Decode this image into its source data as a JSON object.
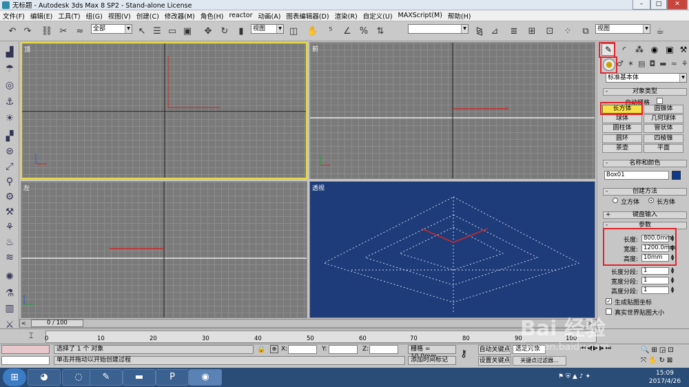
{
  "window": {
    "title": "无标题 - Autodesk 3ds Max 8 SP2  - Stand-alone License",
    "min": "–",
    "max": "□",
    "close": "✕"
  },
  "menu": [
    "文件(F)",
    "编辑(E)",
    "工具(T)",
    "组(G)",
    "视图(V)",
    "创建(C)",
    "修改器(M)",
    "角色(H)",
    "reactor",
    "动画(A)",
    "图表编辑器(D)",
    "渲染(R)",
    "自定义(U)",
    "MAXScript(M)",
    "帮助(H)"
  ],
  "toolbar": {
    "selection_filter": "全部",
    "ref_coord": "视图",
    "named_selection": "",
    "viewport_select": "视图"
  },
  "viewports": {
    "top": "顶",
    "front": "前",
    "left": "左",
    "perspective": "透视"
  },
  "cmd_panel": {
    "category": "标准基本体",
    "rollouts": {
      "object_type": "对象类型",
      "name_color": "名称和颜色",
      "creation_method": "创建方法",
      "keyboard_entry": "键盘输入",
      "parameters": "参数"
    },
    "autogrid": "自动栅格",
    "objects": [
      "长方体",
      "圆锥体",
      "球体",
      "几何球体",
      "圆柱体",
      "管状体",
      "圆环",
      "四棱锥",
      "茶壶",
      "平面"
    ],
    "object_name": "Box01",
    "object_color": "#0b3a8f",
    "creation_methods": [
      "立方体",
      "长方体"
    ],
    "params": {
      "length_label": "长度:",
      "length": "800.0mm",
      "width_label": "宽度:",
      "width": "1200.0mm",
      "height_label": "高度:",
      "height": "10mm",
      "length_segs_label": "长度分段:",
      "length_segs": "1",
      "width_segs_label": "宽度分段:",
      "width_segs": "1",
      "height_segs_label": "高度分段:",
      "height_segs": "1",
      "gen_uv": "生成贴图坐标",
      "real_world": "真实世界贴图大小"
    }
  },
  "timeline": {
    "frame": "0 / 100",
    "ticks": [
      "0",
      "10",
      "20",
      "30",
      "40",
      "50",
      "60",
      "70",
      "80",
      "90",
      "100"
    ]
  },
  "status": {
    "selected": "选择了 1 个 对象",
    "prompt": "单击并拖动以开始创建过程",
    "x_label": "X:",
    "y_label": "Y:",
    "z_label": "Z:",
    "grid": "栅格 = 10.0mm",
    "add_time_tag": "添加时间标记",
    "auto_key": "自动关键点",
    "set_key": "设置关键点",
    "selected_obj": "选定对象",
    "key_filters": "关键点过滤器..."
  },
  "taskbar": {
    "time": "15:09",
    "date": "2017/4/26"
  },
  "watermark": {
    "text": "Bai 经验",
    "url": "jingyan.baidu.com"
  },
  "colors": {
    "active_viewport": "#e8d83a",
    "highlight": "#e8202a",
    "selected_button": "#f8e24a",
    "perspective_bg": "#1e3c7a"
  }
}
